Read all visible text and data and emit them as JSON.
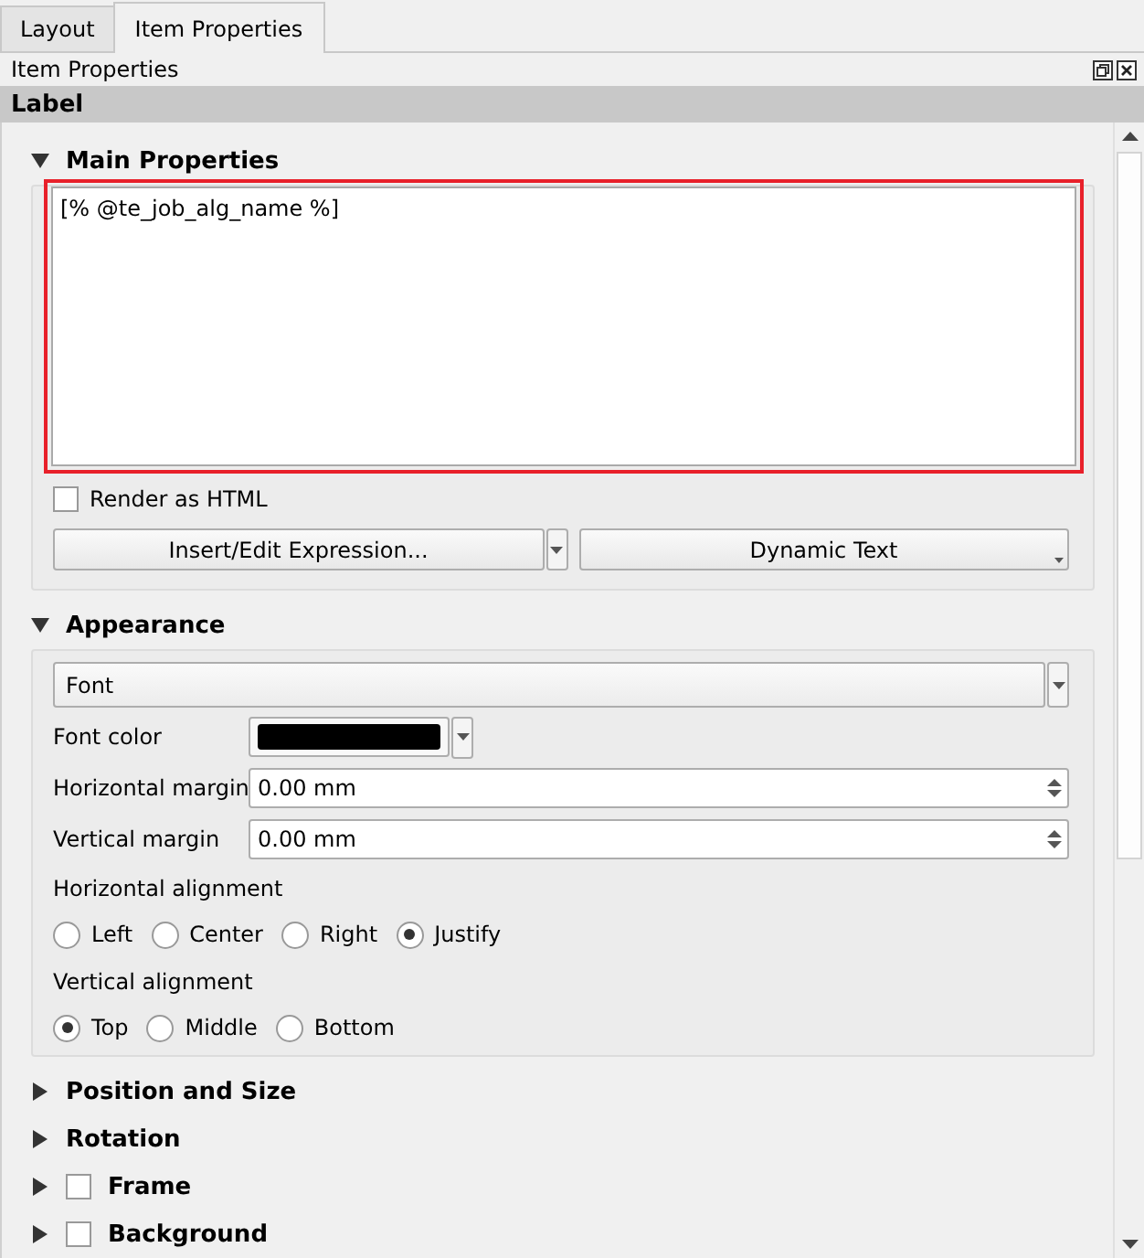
{
  "tabs": [
    {
      "label": "Layout",
      "selected": false
    },
    {
      "label": "Item Properties",
      "selected": true
    }
  ],
  "dock": {
    "title": "Item Properties"
  },
  "item_type": "Label",
  "sections": [
    {
      "kind": "main",
      "title": "Main Properties",
      "expanded": true,
      "text": "[% @te_job_alg_name %]",
      "highlighted": true,
      "render_html": {
        "label": "Render as HTML",
        "checked": false
      },
      "buttons": [
        "Insert/Edit Expression...",
        "Dynamic Text"
      ]
    },
    {
      "kind": "appearance",
      "title": "Appearance",
      "expanded": true,
      "font_button": "Font",
      "font_color": {
        "label": "Font color",
        "color": "#000000"
      },
      "margins": [
        {
          "label": "Horizontal margin",
          "value": "0.00 mm"
        },
        {
          "label": "Vertical margin",
          "value": "0.00 mm"
        }
      ],
      "alignments": [
        {
          "label": "Horizontal alignment",
          "options": [
            {
              "label": "Left",
              "selected": false
            },
            {
              "label": "Center",
              "selected": false
            },
            {
              "label": "Right",
              "selected": false
            },
            {
              "label": "Justify",
              "selected": true
            }
          ]
        },
        {
          "label": "Vertical alignment",
          "options": [
            {
              "label": "Top",
              "selected": true
            },
            {
              "label": "Middle",
              "selected": false
            },
            {
              "label": "Bottom",
              "selected": false
            }
          ]
        }
      ]
    },
    {
      "kind": "plain",
      "title": "Position and Size",
      "expanded": false
    },
    {
      "kind": "plain",
      "title": "Rotation",
      "expanded": false
    },
    {
      "kind": "plain",
      "title": "Frame",
      "expanded": false,
      "checked": false
    },
    {
      "kind": "plain",
      "title": "Background",
      "expanded": false,
      "checked": false
    }
  ]
}
